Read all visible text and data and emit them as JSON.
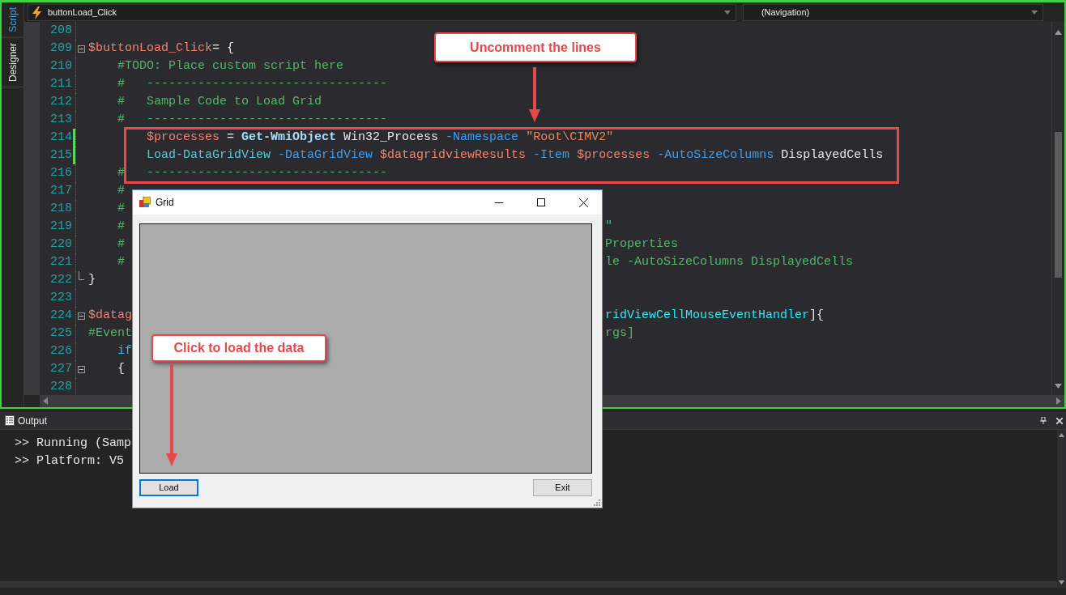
{
  "side_tabs": [
    {
      "label": "Script",
      "selected": true
    },
    {
      "label": "Designer",
      "selected": false
    }
  ],
  "toolbar": {
    "function_dropdown": "buttonLoad_Click",
    "navigation_dropdown": "(Navigation)"
  },
  "editor": {
    "lines": [
      {
        "number": "208",
        "foldable": false,
        "block_end": false,
        "modified": false
      },
      {
        "number": "209",
        "foldable": true,
        "block_end": false,
        "modified": false,
        "tokens": [
          {
            "kind": "variable",
            "text": "$buttonLoad_Click"
          },
          {
            "kind": "plain",
            "text": "= {"
          }
        ]
      },
      {
        "number": "210",
        "foldable": false,
        "block_end": false,
        "modified": false,
        "tokens": [
          {
            "kind": "comment",
            "text": "    #TODO: Place custom script here"
          }
        ]
      },
      {
        "number": "211",
        "foldable": false,
        "block_end": false,
        "modified": false,
        "tokens": [
          {
            "kind": "comment",
            "text": "    #   ---------------------------------"
          }
        ]
      },
      {
        "number": "212",
        "foldable": false,
        "block_end": false,
        "modified": false,
        "tokens": [
          {
            "kind": "comment",
            "text": "    #   Sample Code to Load Grid"
          }
        ]
      },
      {
        "number": "213",
        "foldable": false,
        "block_end": false,
        "modified": false,
        "tokens": [
          {
            "kind": "comment",
            "text": "    #   ---------------------------------"
          }
        ]
      },
      {
        "number": "214",
        "foldable": false,
        "block_end": false,
        "modified": true,
        "tokens": [
          {
            "kind": "variable",
            "text": "        $processes"
          },
          {
            "kind": "plain",
            "text": " = "
          },
          {
            "kind": "command",
            "text": "Get-WmiObject"
          },
          {
            "kind": "plain",
            "text": " Win32_Process "
          },
          {
            "kind": "parameter",
            "text": "-Namespace"
          },
          {
            "kind": "string",
            "text": " \"Root\\CIMV2\""
          }
        ]
      },
      {
        "number": "215",
        "foldable": false,
        "block_end": false,
        "modified": true,
        "tokens": [
          {
            "kind": "function",
            "text": "        Load-DataGridView"
          },
          {
            "kind": "parameter",
            "text": " -DataGridView"
          },
          {
            "kind": "variable",
            "text": " $datagridviewResults"
          },
          {
            "kind": "parameter",
            "text": " -Item"
          },
          {
            "kind": "variable",
            "text": " $processes"
          },
          {
            "kind": "parameter",
            "text": " -AutoSizeColumns"
          },
          {
            "kind": "plain",
            "text": " DisplayedCells"
          }
        ]
      },
      {
        "number": "216",
        "foldable": false,
        "block_end": false,
        "modified": false,
        "tokens": [
          {
            "kind": "comment",
            "text": "    #   ---------------------------------"
          }
        ]
      },
      {
        "number": "217",
        "foldable": false,
        "block_end": false,
        "modified": false,
        "tokens": [
          {
            "kind": "comment",
            "text": "    #"
          }
        ]
      },
      {
        "number": "218",
        "foldable": false,
        "block_end": false,
        "modified": false,
        "tokens": [
          {
            "kind": "comment",
            "text": "    #"
          }
        ]
      },
      {
        "number": "219",
        "foldable": false,
        "block_end": false,
        "modified": false,
        "tokens": [
          {
            "kind": "comment",
            "text": "    #"
          }
        ],
        "right_tokens": [
          {
            "kind": "comment",
            "text": "\""
          }
        ]
      },
      {
        "number": "220",
        "foldable": false,
        "block_end": false,
        "modified": false,
        "tokens": [
          {
            "kind": "comment",
            "text": "    #"
          }
        ],
        "right_tokens": [
          {
            "kind": "comment",
            "text": "Properties"
          }
        ]
      },
      {
        "number": "221",
        "foldable": false,
        "block_end": false,
        "modified": false,
        "tokens": [
          {
            "kind": "comment",
            "text": "    #"
          }
        ],
        "right_tokens": [
          {
            "kind": "comment",
            "text": "le -AutoSizeColumns DisplayedCells"
          }
        ]
      },
      {
        "number": "222",
        "foldable": false,
        "block_end": true,
        "modified": false,
        "tokens": [
          {
            "kind": "plain",
            "text": "}"
          }
        ]
      },
      {
        "number": "223",
        "foldable": false,
        "block_end": false,
        "modified": false
      },
      {
        "number": "224",
        "foldable": true,
        "block_end": false,
        "modified": false,
        "tokens": [
          {
            "kind": "variable",
            "text": "$datag"
          }
        ],
        "right_tokens": [
          {
            "kind": "type",
            "text": "ridViewCellMouseEventHandler"
          },
          {
            "kind": "plain",
            "text": "]{"
          }
        ]
      },
      {
        "number": "225",
        "foldable": false,
        "block_end": false,
        "modified": false,
        "tokens": [
          {
            "kind": "comment",
            "text": "#Event"
          }
        ],
        "right_tokens": [
          {
            "kind": "comment",
            "text": "rgs]"
          }
        ]
      },
      {
        "number": "226",
        "foldable": false,
        "block_end": false,
        "modified": false,
        "tokens": [
          {
            "kind": "keyword",
            "text": "    if"
          }
        ]
      },
      {
        "number": "227",
        "foldable": true,
        "block_end": false,
        "modified": false,
        "tokens": [
          {
            "kind": "plain",
            "text": "    {"
          }
        ]
      },
      {
        "number": "228",
        "foldable": false,
        "block_end": false,
        "modified": false
      }
    ]
  },
  "output": {
    "title": "Output",
    "lines": [
      ">> Running (Samp",
      ">> Platform: V5"
    ]
  },
  "dialog": {
    "title": "Grid",
    "buttons": [
      {
        "label": "Load",
        "selected": true
      },
      {
        "label": "Exit",
        "selected": false
      }
    ]
  },
  "callouts": [
    {
      "kind": "top",
      "text": "Uncomment the lines"
    },
    {
      "kind": "bottom",
      "text": "Click to load the data"
    }
  ]
}
